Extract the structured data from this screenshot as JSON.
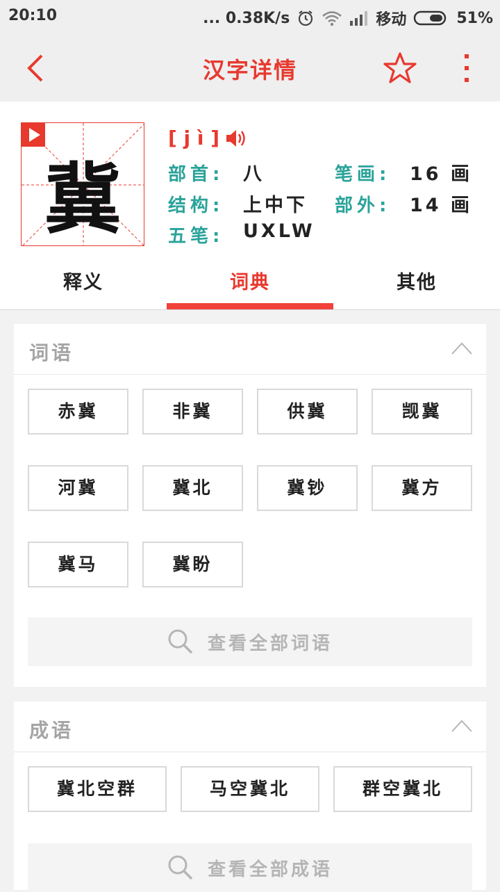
{
  "status_bar": {
    "time": "20:10",
    "net_speed": "... 0.38K/s",
    "carrier": "移动",
    "battery": "51%",
    "icons": [
      "alarm-icon",
      "wifi-icon",
      "signal-icon",
      "battery-icon"
    ]
  },
  "topbar": {
    "title": "汉字详情",
    "icons": [
      "back-arrow-icon",
      "star-icon",
      "more-vertical-icon"
    ]
  },
  "character": {
    "glyph": "冀",
    "pinyin": "[ j ì ]",
    "labels": {
      "radical": "部首:",
      "strokes": "笔画:",
      "structure": "结构:",
      "outer": "部外:",
      "wubi": "五笔:"
    },
    "values": {
      "radical": "八",
      "strokes": "16 画",
      "structure": "上中下",
      "outer": "14 画",
      "wubi": "UXLW"
    }
  },
  "tabs": [
    {
      "label": "释义",
      "active": false
    },
    {
      "label": "词典",
      "active": true
    },
    {
      "label": "其他",
      "active": false
    }
  ],
  "words_section": {
    "title": "词语",
    "items": [
      "赤冀",
      "非冀",
      "供冀",
      "觊冀",
      "河冀",
      "冀北",
      "冀钞",
      "冀方",
      "冀马",
      "冀盼"
    ],
    "view_all": "查看全部词语"
  },
  "idioms_section": {
    "title": "成语",
    "items": [
      "冀北空群",
      "马空冀北",
      "群空冀北"
    ],
    "view_all": "查看全部成语"
  },
  "colors": {
    "accent": "#e8392f",
    "teal": "#2aa39a"
  }
}
